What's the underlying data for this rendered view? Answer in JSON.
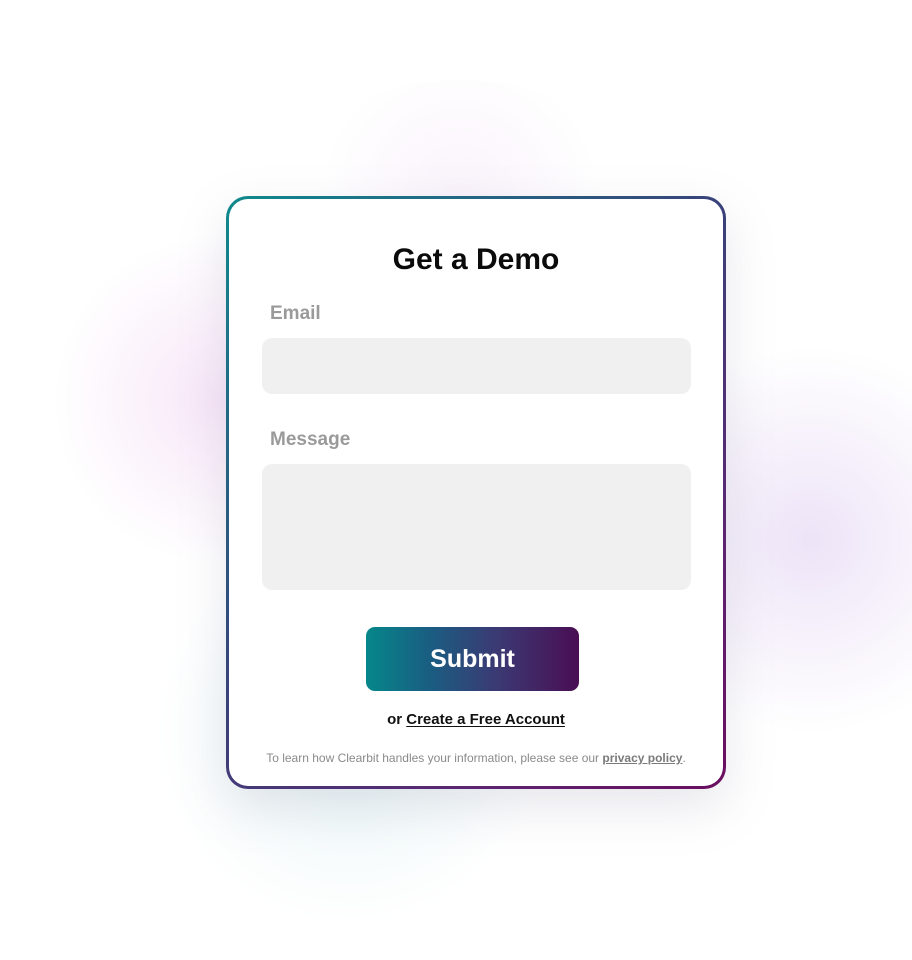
{
  "form": {
    "title": "Get a Demo",
    "email_label": "Email",
    "email_value": "",
    "message_label": "Message",
    "message_value": "",
    "submit_label": "Submit",
    "alt_prefix": "or",
    "alt_link_label": "Create a Free Account",
    "footnote_prefix": "To learn how Clearbit handles your information, please see our",
    "privacy_link_label": "privacy policy",
    "footnote_suffix": "."
  },
  "colors": {
    "gradient_start": "#05878a",
    "gradient_end": "#4a0e54",
    "input_background": "#f0f0f0",
    "label_color": "#9a9a9a"
  }
}
